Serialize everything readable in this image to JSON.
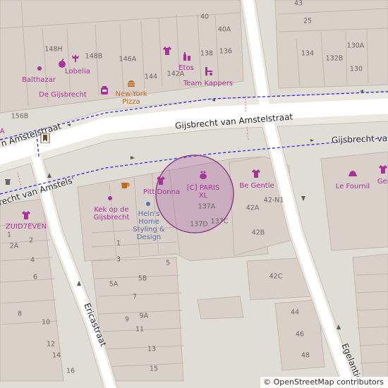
{
  "streets": {
    "main": "Gijsbrecht van Amstelstraat",
    "main_right": "Gijsbrecht van A",
    "main_left_top": "n Amstelstraat",
    "main_left_bottom": "recht van Amstels'",
    "erica": "Ericastraat",
    "egelantier": "Egelantie"
  },
  "pois": {
    "balthazar": "Balthazar",
    "lobelia": "Lobelia",
    "gijsbrecht": "De Gijsbrecht",
    "new_york_pizza": "New-York Pizza",
    "etos": "Etos",
    "team_kappers": "Team Kappers",
    "kek": "Kek op de Gijsbrecht",
    "pitt_donna": "Pitt Donna",
    "heins": "Hein's Home Styling & Design",
    "ci_paris": "[C] PARIS XL",
    "be_gentle": "Be Gentle",
    "le_fournil": "Le Fournil",
    "gen": "Gen",
    "zuid7even": "ZUID7EVEN",
    "a_left": "A"
  },
  "house_numbers": {
    "n43": "43",
    "n40": "40",
    "n40a": "40A",
    "n25": "25",
    "n148h": "148H",
    "n148b": "148B",
    "n146a": "146A",
    "n138": "138",
    "n136": "136",
    "n144": "144",
    "n142a": "142A",
    "n134": "134",
    "n132b": "132B",
    "n130a": "130A",
    "n130": "130",
    "n156b": "156B",
    "n137a": "137A",
    "n137d": "137D",
    "n137c": "137C",
    "n42a": "42A",
    "n42n1": "42-N1",
    "n42b": "42B",
    "n42c": "42C",
    "n44": "44",
    "n46": "46",
    "n48": "48",
    "n1": "1",
    "n2": "2",
    "n2a": "2A",
    "n4": "4",
    "n6": "6",
    "n8": "8",
    "n10": "10",
    "n12": "12",
    "n14": "14",
    "n16": "16",
    "n3": "3",
    "n5": "5",
    "n5a": "5A",
    "n5b": "5B",
    "n7": "7",
    "n9": "9",
    "n9a": "9A",
    "n11": "11",
    "n13": "13",
    "n15": "15"
  },
  "attribution": {
    "symbol": "©",
    "text": "OpenStreetMap contributors"
  },
  "colors": {
    "background": "#e0dcd6",
    "building": "#d9d0c9",
    "building_outline": "#c4b6ab",
    "road": "#ffffff",
    "road_casing": "#c9c2b8",
    "cycleway": "#1a1aff",
    "poi": "#a8329a",
    "marker_fill": "#b06ea8",
    "marker_stroke": "#8e3f88"
  }
}
